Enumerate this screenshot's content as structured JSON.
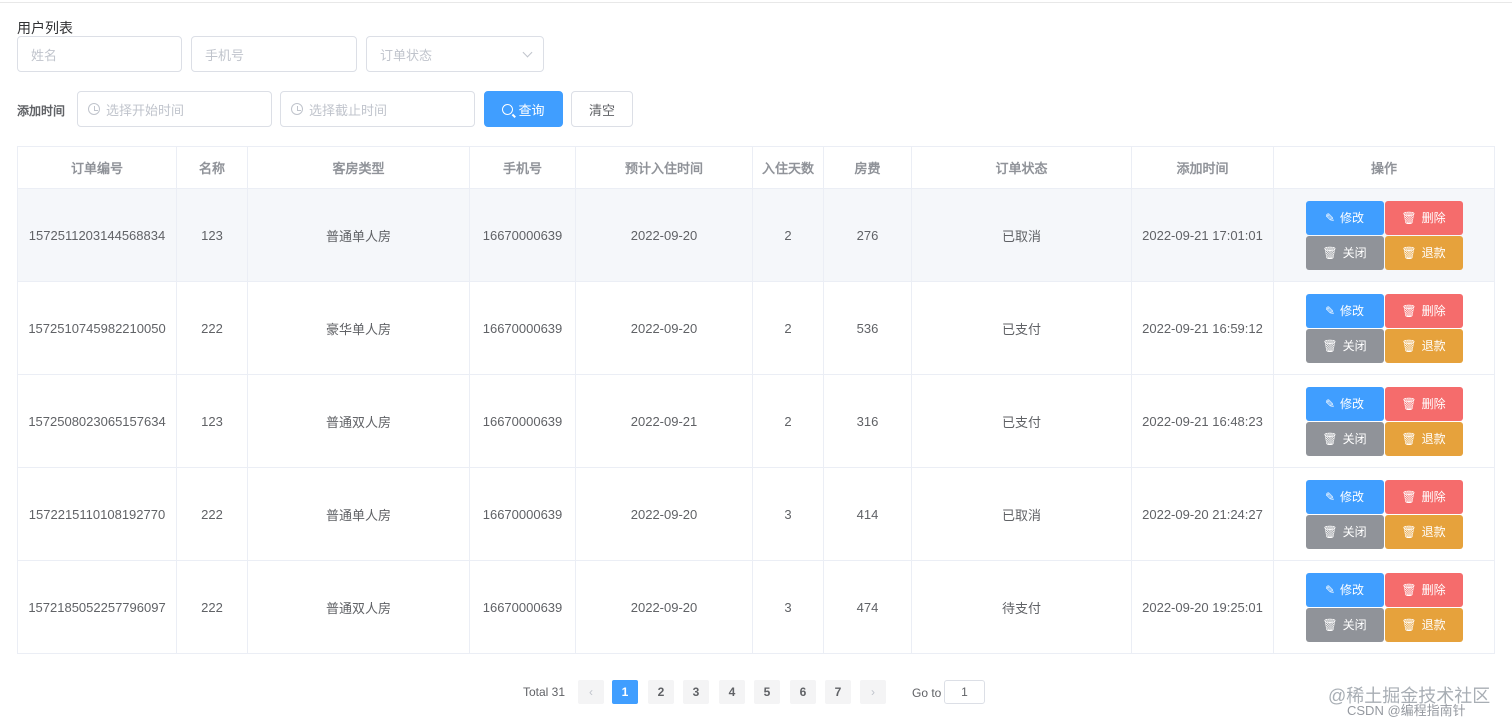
{
  "page": {
    "title": "用户列表"
  },
  "filters": {
    "name_placeholder": "姓名",
    "phone_placeholder": "手机号",
    "status_placeholder": "订单状态",
    "time_label": "添加时间",
    "start_placeholder": "选择开始时间",
    "end_placeholder": "选择截止时间",
    "search_label": "查询",
    "clear_label": "清空"
  },
  "table": {
    "columns": [
      "订单编号",
      "名称",
      "客房类型",
      "手机号",
      "预计入住时间",
      "入住天数",
      "房费",
      "订单状态",
      "添加时间",
      "操作"
    ],
    "rows": [
      [
        "1572511203144568834",
        "123",
        "普通单人房",
        "16670000639",
        "2022-09-20",
        "2",
        "276",
        "已取消",
        "2022-09-21 17:01:01"
      ],
      [
        "1572510745982210050",
        "222",
        "豪华单人房",
        "16670000639",
        "2022-09-20",
        "2",
        "536",
        "已支付",
        "2022-09-21 16:59:12"
      ],
      [
        "1572508023065157634",
        "123",
        "普通双人房",
        "16670000639",
        "2022-09-21",
        "2",
        "316",
        "已支付",
        "2022-09-21 16:48:23"
      ],
      [
        "1572215110108192770",
        "222",
        "普通单人房",
        "16670000639",
        "2022-09-20",
        "3",
        "414",
        "已取消",
        "2022-09-20 21:24:27"
      ],
      [
        "1572185052257796097",
        "222",
        "普通双人房",
        "16670000639",
        "2022-09-20",
        "3",
        "474",
        "待支付",
        "2022-09-20 19:25:01"
      ]
    ],
    "actions": {
      "edit": "修改",
      "delete": "删除",
      "close": "关闭",
      "refund": "退款"
    }
  },
  "pagination": {
    "total": "Total 31",
    "pages": [
      "1",
      "2",
      "3",
      "4",
      "5",
      "6",
      "7"
    ],
    "current": "1",
    "goto_label": "Go to",
    "goto_value": "1"
  },
  "watermark": {
    "line1": "@稀土掘金技术社区",
    "line2": "CSDN @编程指南针"
  },
  "colors": {
    "primary": "#409eff",
    "danger": "#f56c6c",
    "info": "#909399",
    "warning": "#e6a23c"
  }
}
